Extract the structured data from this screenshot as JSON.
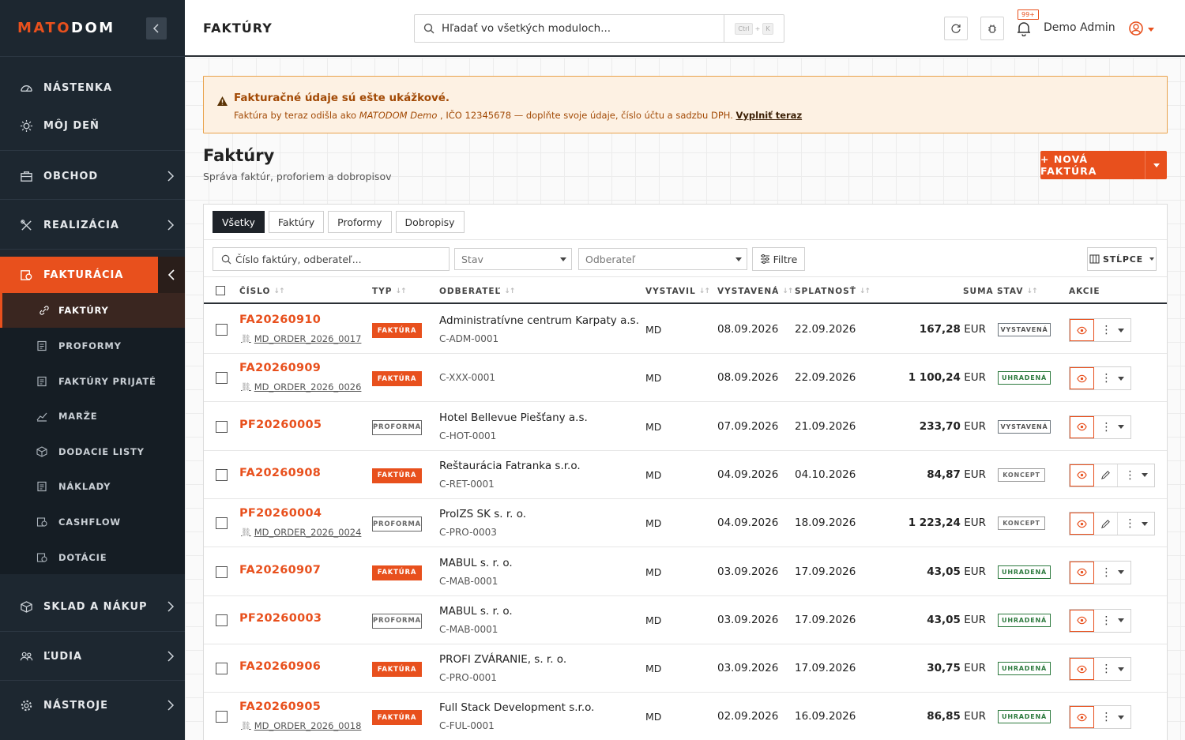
{
  "brand": {
    "logo_a": "MATO",
    "logo_b": "DOM"
  },
  "sidebar": {
    "items": [
      {
        "label": "NÁSTENKA"
      },
      {
        "label": "MÔJ DEŇ"
      },
      {
        "label": "OBCHOD"
      },
      {
        "label": "REALIZÁCIA"
      },
      {
        "label": "FAKTURÁCIA"
      },
      {
        "label": "SKLAD A NÁKUP"
      },
      {
        "label": "ĽUDIA"
      },
      {
        "label": "NÁSTROJE"
      }
    ],
    "sub_items": [
      {
        "label": "FAKTÚRY"
      },
      {
        "label": "PROFORMY"
      },
      {
        "label": "FAKTÚRY PRIJATÉ"
      },
      {
        "label": "MARŽE"
      },
      {
        "label": "DODACIE LISTY"
      },
      {
        "label": "NÁKLADY"
      },
      {
        "label": "CASHFLOW"
      },
      {
        "label": "DOTÁCIE"
      }
    ]
  },
  "topbar": {
    "title": "FAKTÚRY",
    "search_placeholder": "Hľadať vo všetkých moduloch...",
    "kbd_ctrl": "Ctrl",
    "kbd_plus": "+",
    "kbd_k": "K",
    "notif_badge": "99+",
    "user_name": "Demo Admin"
  },
  "warning": {
    "title": "Fakturačné údaje sú ešte ukážkové.",
    "text_before": "Faktúra by teraz odišla ako ",
    "company": "MATODOM Demo",
    "text_after": " , IČO 12345678 — doplňte svoje údaje, číslo účtu a sadzbu DPH. ",
    "link": "Vyplniť teraz"
  },
  "header": {
    "title": "Faktúry",
    "subtitle": "Správa faktúr, proforiem a dobropisov",
    "new_button": "+  NOVÁ FAKTÚRA"
  },
  "tabs": [
    {
      "label": "Všetky"
    },
    {
      "label": "Faktúry"
    },
    {
      "label": "Proformy"
    },
    {
      "label": "Dobropisy"
    }
  ],
  "filters": {
    "search_placeholder": "Číslo faktúry, odberateľ...",
    "stav": "Stav",
    "odberatel": "Odberateľ",
    "filter_btn": "Filtre",
    "columns_btn": "STĹPCE"
  },
  "columns": {
    "cislo": "ČÍSLO",
    "typ": "TYP",
    "odberatel": "ODBERATEĽ",
    "vystavil": "VYSTAVIL",
    "vystavena": "VYSTAVENÁ",
    "splatnost": "SPLATNOSŤ",
    "suma": "SUMA",
    "stav": "STAV",
    "akcie": "AKCIE"
  },
  "rows": [
    {
      "number": "FA20260910",
      "ref": "MD_ORDER_2026_0017",
      "type": "FAKTÚRA",
      "type_kind": "faktura",
      "customer": "Administratívne centrum Karpaty a.s.",
      "code": "C-ADM-0001",
      "issuer": "MD",
      "issued": "08.09.2026",
      "due": "22.09.2026",
      "amount": "167,28",
      "currency": "EUR",
      "status": "VYSTAVENÁ",
      "status_kind": "vy",
      "editable": false
    },
    {
      "number": "FA20260909",
      "ref": "MD_ORDER_2026_0026",
      "type": "FAKTÚRA",
      "type_kind": "faktura",
      "customer": "",
      "code": "C-XXX-0001",
      "issuer": "MD",
      "issued": "08.09.2026",
      "due": "22.09.2026",
      "amount": "1 100,24",
      "currency": "EUR",
      "status": "UHRADENÁ",
      "status_kind": "uh",
      "editable": false
    },
    {
      "number": "PF20260005",
      "ref": "",
      "type": "PROFORMA",
      "type_kind": "proforma",
      "customer": "Hotel Bellevue Piešťany a.s.",
      "code": "C-HOT-0001",
      "issuer": "MD",
      "issued": "07.09.2026",
      "due": "21.09.2026",
      "amount": "233,70",
      "currency": "EUR",
      "status": "VYSTAVENÁ",
      "status_kind": "vy",
      "editable": false
    },
    {
      "number": "FA20260908",
      "ref": "",
      "type": "FAKTÚRA",
      "type_kind": "faktura",
      "customer": "Reštaurácia Fatranka s.r.o.",
      "code": "C-RET-0001",
      "issuer": "MD",
      "issued": "04.09.2026",
      "due": "04.10.2026",
      "amount": "84,87",
      "currency": "EUR",
      "status": "KONCEPT",
      "status_kind": "ko",
      "editable": true
    },
    {
      "number": "PF20260004",
      "ref": "MD_ORDER_2026_0024",
      "type": "PROFORMA",
      "type_kind": "proforma",
      "customer": "ProIZS SK s. r. o.",
      "code": "C-PRO-0003",
      "issuer": "MD",
      "issued": "04.09.2026",
      "due": "18.09.2026",
      "amount": "1 223,24",
      "currency": "EUR",
      "status": "KONCEPT",
      "status_kind": "ko",
      "editable": true
    },
    {
      "number": "FA20260907",
      "ref": "",
      "type": "FAKTÚRA",
      "type_kind": "faktura",
      "customer": "MABUL s. r. o.",
      "code": "C-MAB-0001",
      "issuer": "MD",
      "issued": "03.09.2026",
      "due": "17.09.2026",
      "amount": "43,05",
      "currency": "EUR",
      "status": "UHRADENÁ",
      "status_kind": "uh",
      "editable": false
    },
    {
      "number": "PF20260003",
      "ref": "",
      "type": "PROFORMA",
      "type_kind": "proforma",
      "customer": "MABUL s. r. o.",
      "code": "C-MAB-0001",
      "issuer": "MD",
      "issued": "03.09.2026",
      "due": "17.09.2026",
      "amount": "43,05",
      "currency": "EUR",
      "status": "UHRADENÁ",
      "status_kind": "uh",
      "editable": false
    },
    {
      "number": "FA20260906",
      "ref": "",
      "type": "FAKTÚRA",
      "type_kind": "faktura",
      "customer": "PROFI ZVÁRANIE, s. r. o.",
      "code": "C-PRO-0001",
      "issuer": "MD",
      "issued": "03.09.2026",
      "due": "17.09.2026",
      "amount": "30,75",
      "currency": "EUR",
      "status": "UHRADENÁ",
      "status_kind": "uh",
      "editable": false
    },
    {
      "number": "FA20260905",
      "ref": "MD_ORDER_2026_0018",
      "type": "FAKTÚRA",
      "type_kind": "faktura",
      "customer": "Full Stack Development s.r.o.",
      "code": "C-FUL-0001",
      "issuer": "MD",
      "issued": "02.09.2026",
      "due": "16.09.2026",
      "amount": "86,85",
      "currency": "EUR",
      "status": "UHRADENÁ",
      "status_kind": "uh",
      "editable": false
    }
  ],
  "colors": {
    "accent": "#e8501d",
    "sidebar": "#1d2730",
    "success": "#2d7a3e",
    "warning_bg": "#fdf1e3"
  }
}
